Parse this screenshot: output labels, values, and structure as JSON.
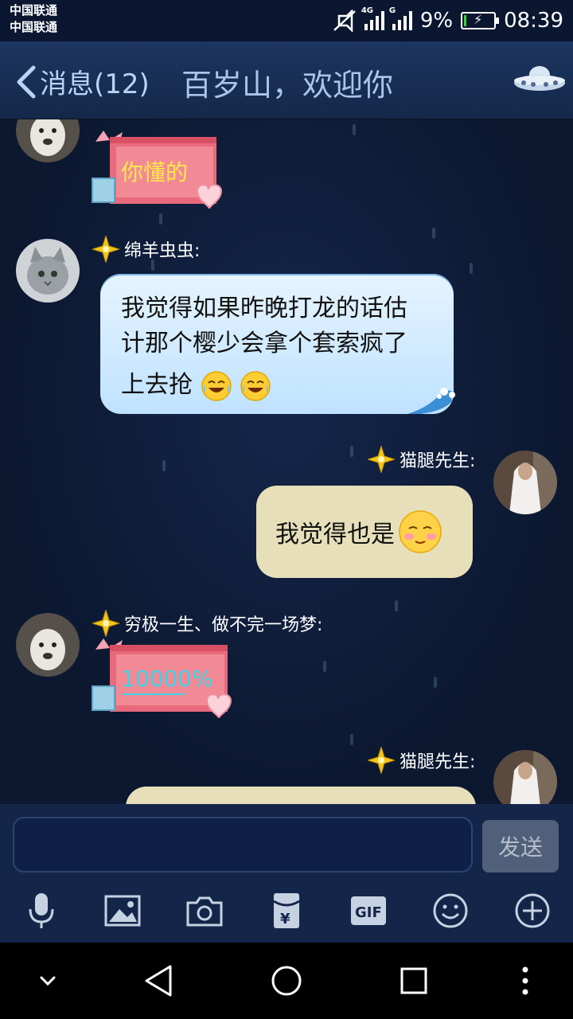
{
  "status_bar": {
    "carrier_1": "中国联通",
    "carrier_2": "中国联通",
    "network_1": "4G",
    "network_2": "G",
    "battery_percent": "9%",
    "battery_level": 0.09,
    "time": "08:39"
  },
  "header": {
    "back_label": "消息(12)",
    "title": "百岁山，欢迎你",
    "menu_icon": "ufo-icon"
  },
  "messages": [
    {
      "sender": "",
      "side": "left",
      "type": "gift-sticker",
      "sticker_text": "你懂的"
    },
    {
      "sender": "绵羊虫虫:",
      "side": "left",
      "type": "text",
      "lines": [
        "我觉得如果昨晚打龙的话估",
        "计那个樱少会拿个套索疯了",
        "上去抢"
      ],
      "emoji": [
        "laugh-cry-emoji",
        "laugh-cry-emoji"
      ]
    },
    {
      "sender": "猫腿先生:",
      "side": "right",
      "type": "text",
      "text": "我觉得也是",
      "emoji": [
        "blush-emoji"
      ]
    },
    {
      "sender": "穷极一生、做不完一场梦:",
      "side": "left",
      "type": "gift-sticker",
      "sticker_text": "10000%"
    },
    {
      "sender": "猫腿先生:",
      "side": "right",
      "type": "text",
      "text": ""
    }
  ],
  "composer": {
    "input_value": "",
    "send_label": "发送"
  },
  "toolbar": {
    "items": [
      "microphone-icon",
      "image-icon",
      "camera-icon",
      "red-packet-icon",
      "gif-icon",
      "emoji-icon",
      "plus-icon"
    ],
    "gif_label": "GIF"
  },
  "system_nav": {
    "items": [
      "collapse-icon",
      "back-icon",
      "home-icon",
      "recents-icon",
      "more-icon"
    ]
  }
}
